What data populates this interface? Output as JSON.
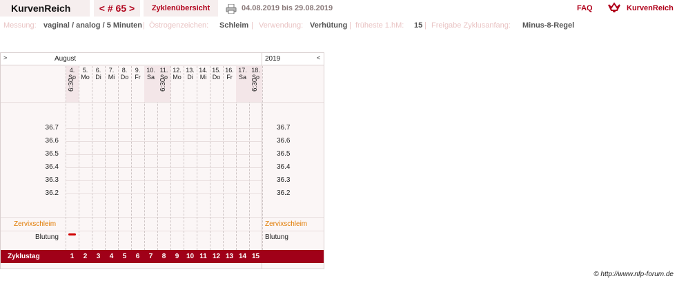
{
  "header": {
    "brand": "KurvenReich",
    "cycle_label": "< # 65 >",
    "overview_label": "Zyklenübersicht",
    "date_range": "04.08.2019 bis 29.08.2019",
    "faq_label": "FAQ",
    "logo_text": "KurvenReich",
    "print_icon": "printer-icon"
  },
  "info": {
    "measure_label": "Messung:",
    "measure_value": "vaginal / analog / 5 Minuten",
    "estrogen_label": "Östrogenzeichen:",
    "estrogen_value": "Schleim",
    "usage_label": "Verwendung:",
    "usage_value": "Verhütung",
    "earliest_label": "früheste 1.hM:",
    "earliest_value": "15",
    "release_label": "Freigabe Zyklusanfang:",
    "release_value": "Minus-8-Regel",
    "separator": "|"
  },
  "chart": {
    "month_label": "August",
    "year_label": "2019",
    "nav_left": ">",
    "nav_right": "<",
    "days": [
      {
        "num": "4.",
        "wd": "So",
        "time": "6:30"
      },
      {
        "num": "5.",
        "wd": "Mo",
        "time": ""
      },
      {
        "num": "6.",
        "wd": "Di",
        "time": ""
      },
      {
        "num": "7.",
        "wd": "Mi",
        "time": ""
      },
      {
        "num": "8.",
        "wd": "Do",
        "time": ""
      },
      {
        "num": "9.",
        "wd": "Fr",
        "time": ""
      },
      {
        "num": "10.",
        "wd": "Sa",
        "time": ""
      },
      {
        "num": "11.",
        "wd": "So",
        "time": "6:30"
      },
      {
        "num": "12.",
        "wd": "Mo",
        "time": ""
      },
      {
        "num": "13.",
        "wd": "Di",
        "time": ""
      },
      {
        "num": "14.",
        "wd": "Mi",
        "time": ""
      },
      {
        "num": "15.",
        "wd": "Do",
        "time": ""
      },
      {
        "num": "16.",
        "wd": "Fr",
        "time": ""
      },
      {
        "num": "17.",
        "wd": "Sa",
        "time": ""
      },
      {
        "num": "18.",
        "wd": "So",
        "time": "6:30"
      }
    ],
    "temps": [
      "36.7",
      "36.6",
      "36.5",
      "36.4",
      "36.3",
      "36.2"
    ],
    "mucus_label": "Zervixschleim",
    "bleeding_label": "Blutung",
    "bleeding_days": [
      1
    ],
    "cycle_day_label": "Zyklustag",
    "cycle_days": [
      "1",
      "2",
      "3",
      "4",
      "5",
      "6",
      "7",
      "8",
      "9",
      "10",
      "11",
      "12",
      "13",
      "14",
      "15"
    ]
  },
  "footer": {
    "credit": "© http://www.nfp-forum.de"
  },
  "colors": {
    "accent": "#b0001a",
    "mucus": "#e07a00",
    "bleeding": "#d00000"
  }
}
